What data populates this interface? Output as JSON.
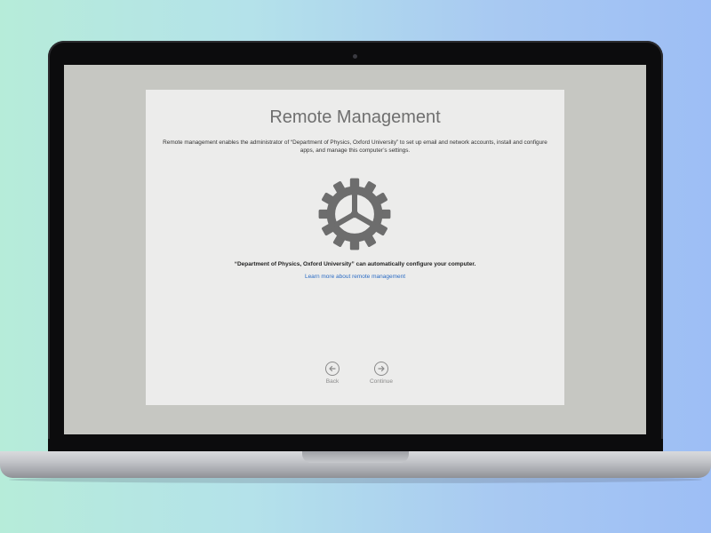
{
  "dialog": {
    "title": "Remote Management",
    "description": "Remote management enables the administrator of “Department of Physics, Oxford University” to set up email and network accounts, install and configure apps, and manage this computer’s settings.",
    "icon": "gear-icon",
    "statement": "“Department of Physics, Oxford University” can automatically configure your computer.",
    "learn_more_link": "Learn more about remote management"
  },
  "nav": {
    "back_label": "Back",
    "back_icon": "arrow-left-circle-icon",
    "continue_label": "Continue",
    "continue_icon": "arrow-right-circle-icon"
  },
  "colors": {
    "link": "#2b6cc4",
    "dialog_background": "#ececeb",
    "screen_background": "#c6c7c2",
    "gear": "#6d6d6d"
  }
}
